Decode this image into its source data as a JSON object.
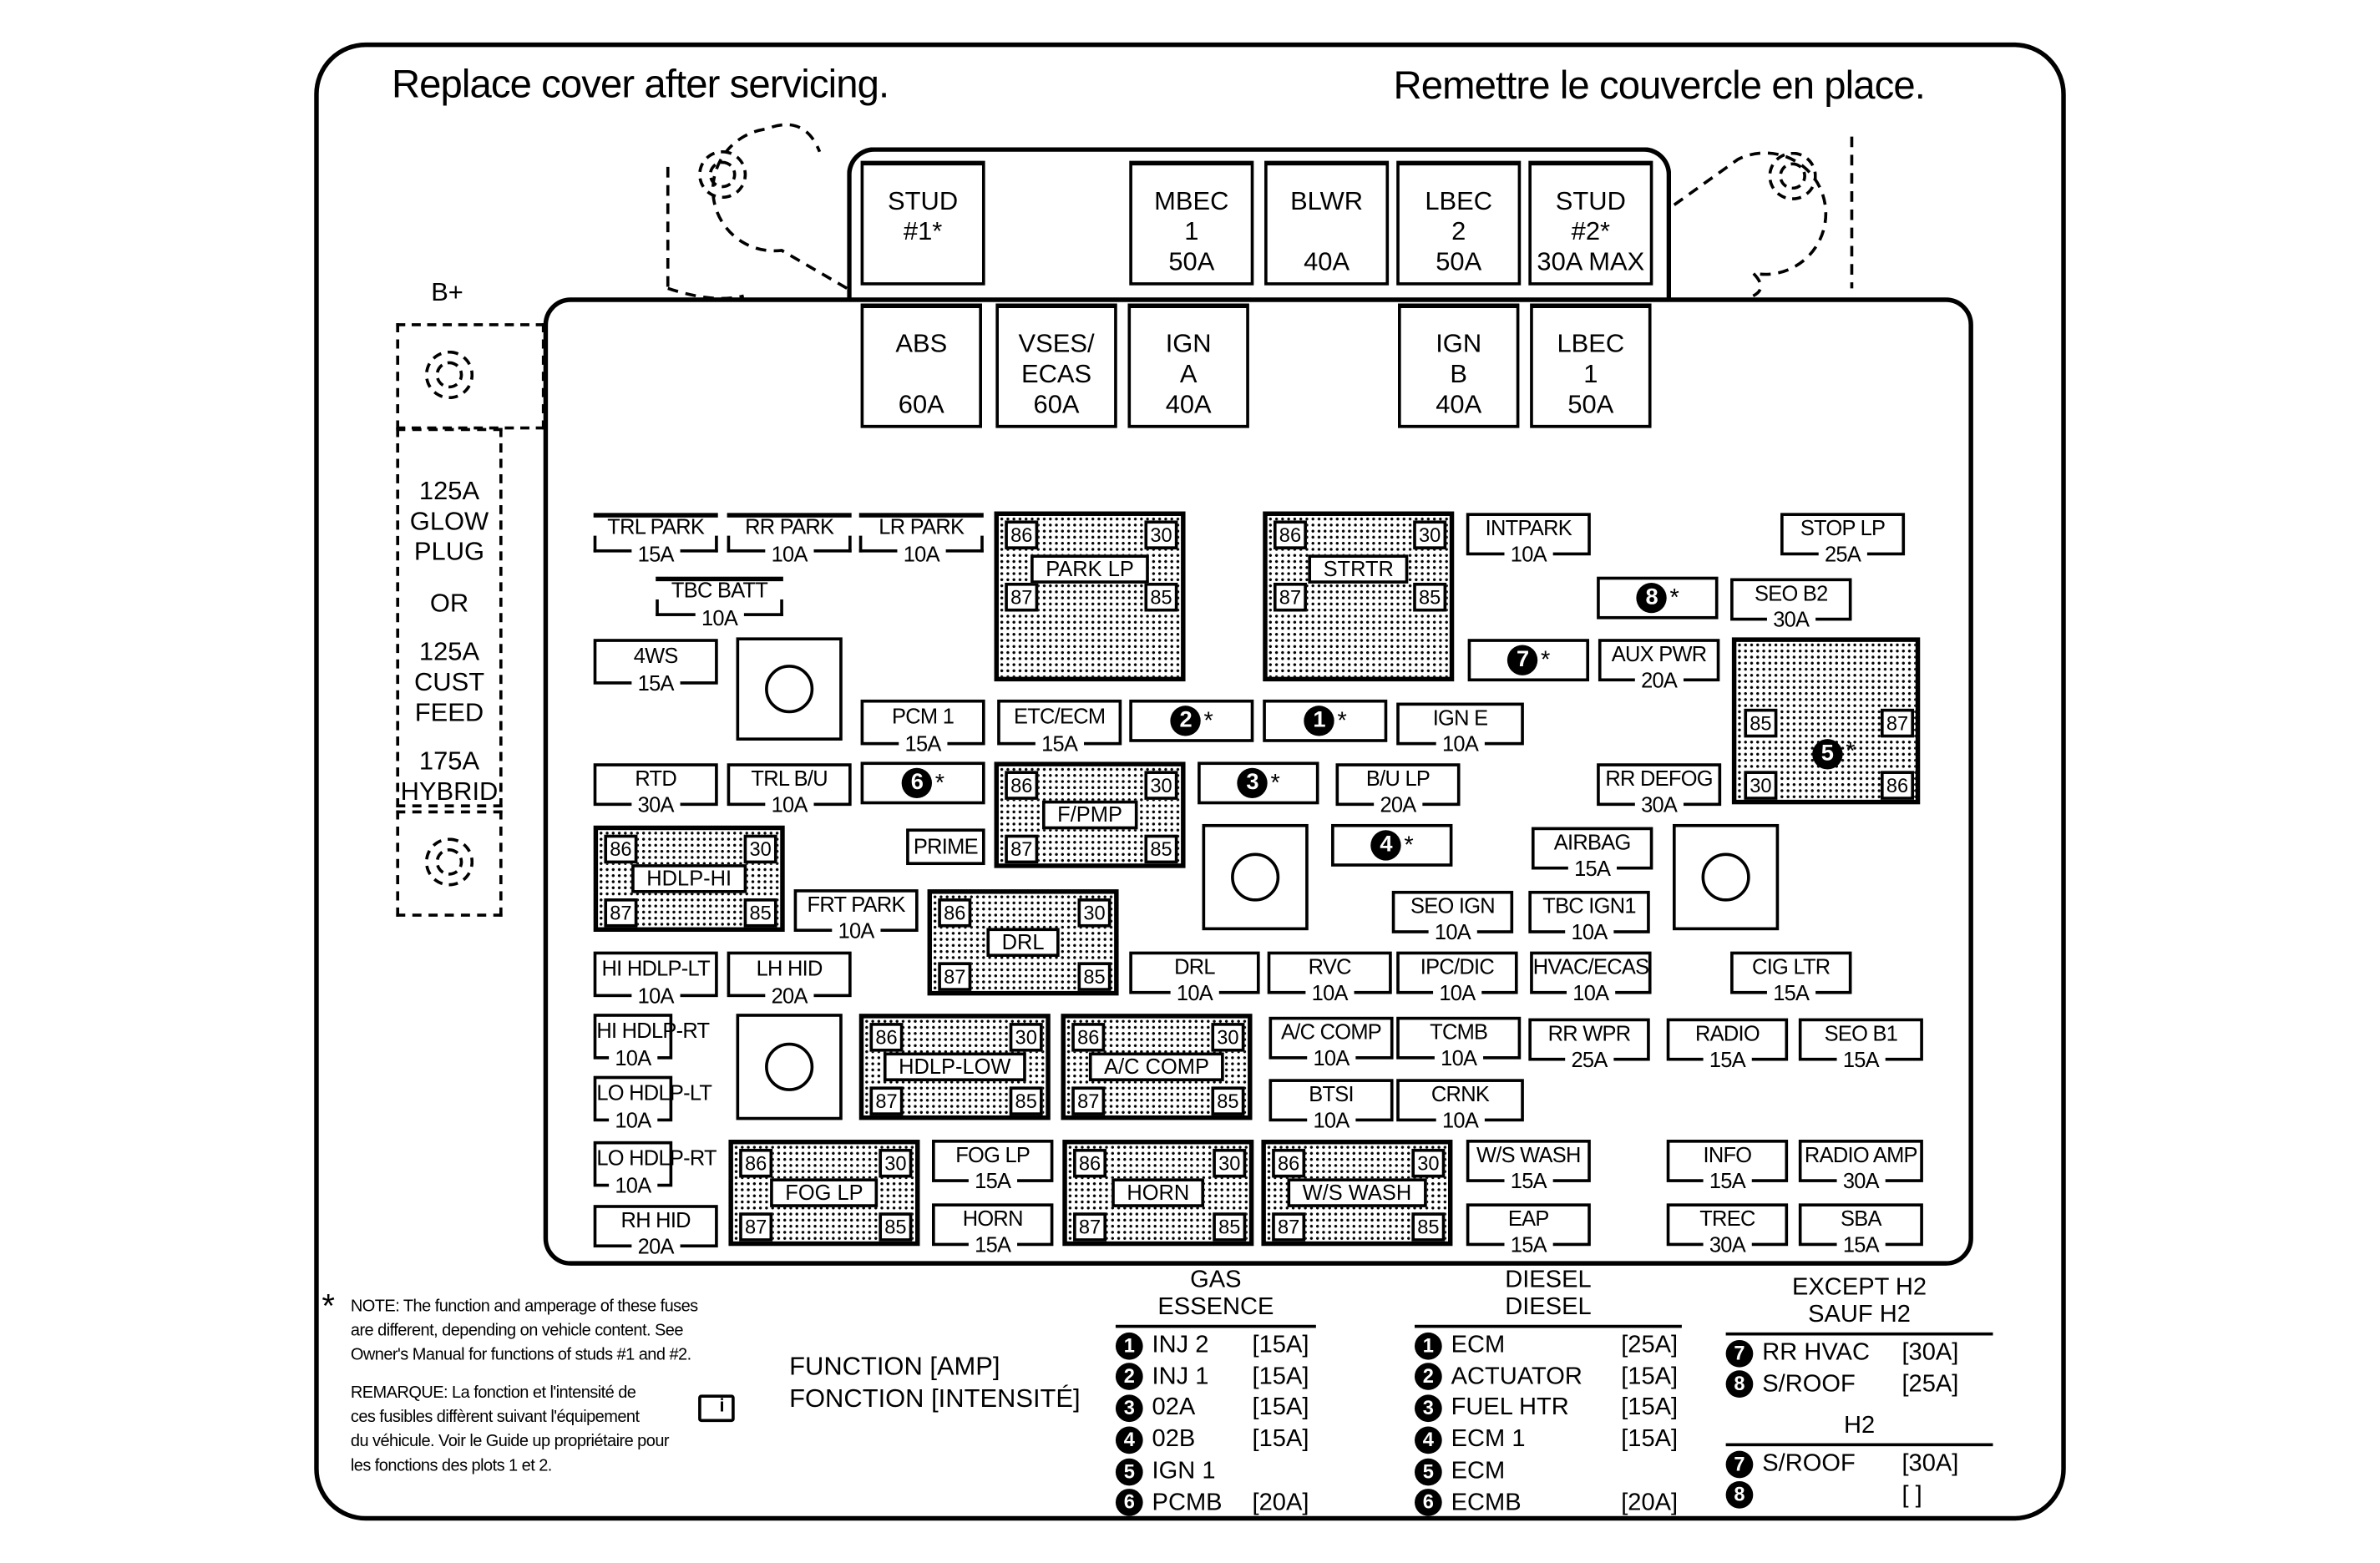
{
  "header": {
    "left_title": "Replace cover after servicing.",
    "right_title": "Remettre le couvercle en place."
  },
  "battery": {
    "label": "B+",
    "options": [
      "125A",
      "GLOW",
      "PLUG",
      "OR",
      "125A",
      "CUST",
      "FEED",
      "175A",
      "HYBRID"
    ]
  },
  "maxi_fuses_top": [
    {
      "lines": [
        "STUD",
        "#1*",
        ""
      ]
    },
    {
      "lines": [
        "MBEC",
        "1",
        "50A"
      ]
    },
    {
      "lines": [
        "BLWR",
        "",
        "40A"
      ]
    },
    {
      "lines": [
        "LBEC",
        "2",
        "50A"
      ]
    },
    {
      "lines": [
        "STUD",
        "#2*",
        "30A MAX"
      ]
    }
  ],
  "maxi_fuses_bottom": [
    {
      "lines": [
        "ABS",
        "",
        "60A"
      ]
    },
    {
      "lines": [
        "VSES/",
        "ECAS",
        "60A"
      ]
    },
    {
      "lines": [
        "IGN",
        "A",
        "40A"
      ]
    },
    {
      "lines": [
        "IGN",
        "B",
        "40A"
      ]
    },
    {
      "lines": [
        "LBEC",
        "1",
        "50A"
      ]
    }
  ],
  "mini_fuses": [
    {
      "name": "TRL PARK",
      "amp": "15A"
    },
    {
      "name": "RR PARK",
      "amp": "10A"
    },
    {
      "name": "LR PARK",
      "amp": "10A"
    },
    {
      "name": "TBC BATT",
      "amp": "10A"
    },
    {
      "name": "4WS",
      "amp": "15A"
    },
    {
      "name": "PCM 1",
      "amp": "15A"
    },
    {
      "name": "ETC/ECM",
      "amp": "15A"
    },
    {
      "name": "RTD",
      "amp": "30A"
    },
    {
      "name": "TRL B/U",
      "amp": "10A"
    },
    {
      "name": "PRIME",
      "amp": ""
    },
    {
      "name": "FRT PARK",
      "amp": "10A"
    },
    {
      "name": "HI HDLP-LT",
      "amp": "10A"
    },
    {
      "name": "LH HID",
      "amp": "20A"
    },
    {
      "name": "HI HDLP-RT",
      "amp": "10A"
    },
    {
      "name": "LO HDLP-LT",
      "amp": "10A"
    },
    {
      "name": "LO HDLP-RT",
      "amp": "10A"
    },
    {
      "name": "RH HID",
      "amp": "20A"
    },
    {
      "name": "FOG LP",
      "amp": "15A"
    },
    {
      "name": "HORN",
      "amp": "15A"
    },
    {
      "name": "INTPARK",
      "amp": "10A"
    },
    {
      "name": "STOP LP",
      "amp": "25A"
    },
    {
      "name": "SEO B2",
      "amp": "30A"
    },
    {
      "name": "AUX PWR",
      "amp": "20A"
    },
    {
      "name": "IGN E",
      "amp": "10A"
    },
    {
      "name": "B/U LP",
      "amp": "20A"
    },
    {
      "name": "RR DEFOG",
      "amp": "30A"
    },
    {
      "name": "AIRBAG",
      "amp": "15A"
    },
    {
      "name": "SEO IGN",
      "amp": "10A"
    },
    {
      "name": "TBC IGN1",
      "amp": "10A"
    },
    {
      "name": "DRL",
      "amp": "10A"
    },
    {
      "name": "RVC",
      "amp": "10A"
    },
    {
      "name": "IPC/DIC",
      "amp": "10A"
    },
    {
      "name": "HVAC/ECAS",
      "amp": "10A"
    },
    {
      "name": "CIG LTR",
      "amp": "15A"
    },
    {
      "name": "A/C COMP",
      "amp": "10A"
    },
    {
      "name": "TCMB",
      "amp": "10A"
    },
    {
      "name": "RR WPR",
      "amp": "25A"
    },
    {
      "name": "RADIO",
      "amp": "15A"
    },
    {
      "name": "SEO B1",
      "amp": "15A"
    },
    {
      "name": "BTSI",
      "amp": "10A"
    },
    {
      "name": "CRNK",
      "amp": "10A"
    },
    {
      "name": "W/S WASH",
      "amp": "15A"
    },
    {
      "name": "EAP",
      "amp": "15A"
    },
    {
      "name": "INFO",
      "amp": "15A"
    },
    {
      "name": "RADIO AMP",
      "amp": "30A"
    },
    {
      "name": "TREC",
      "amp": "30A"
    },
    {
      "name": "SBA",
      "amp": "15A"
    }
  ],
  "numbered_fuses": [
    {
      "num": "2",
      "mark": "*"
    },
    {
      "num": "1",
      "mark": "*"
    },
    {
      "num": "6",
      "mark": "*"
    },
    {
      "num": "3",
      "mark": "*"
    },
    {
      "num": "4",
      "mark": "*"
    },
    {
      "num": "8",
      "mark": "*"
    },
    {
      "num": "7",
      "mark": "*"
    }
  ],
  "relays": [
    {
      "label": "PARK LP",
      "pins": [
        "86",
        "30",
        "87",
        "85"
      ]
    },
    {
      "label": "STRTR",
      "pins": [
        "86",
        "30",
        "87",
        "85"
      ]
    },
    {
      "label": "F/PMP",
      "pins": [
        "86",
        "30",
        "87",
        "85"
      ]
    },
    {
      "label": "HDLP-HI",
      "pins": [
        "86",
        "30",
        "87",
        "85"
      ]
    },
    {
      "label": "DRL",
      "pins": [
        "86",
        "30",
        "87",
        "85"
      ]
    },
    {
      "label": "HDLP-LOW",
      "pins": [
        "86",
        "30",
        "87",
        "85"
      ]
    },
    {
      "label": "A/C COMP",
      "pins": [
        "86",
        "30",
        "87",
        "85"
      ]
    },
    {
      "label": "FOG LP",
      "pins": [
        "86",
        "30",
        "87",
        "85"
      ]
    },
    {
      "label": "HORN",
      "pins": [
        "86",
        "30",
        "87",
        "85"
      ]
    },
    {
      "label": "W/S WASH",
      "pins": [
        "86",
        "30",
        "87",
        "85"
      ]
    }
  ],
  "relay5": {
    "num": "5",
    "mark": "*",
    "pins": [
      "85",
      "87",
      "30",
      "86"
    ]
  },
  "note": {
    "star": "*",
    "english": [
      "NOTE:  The function and amperage of these fuses",
      "are different, depending on vehicle content. See",
      "Owner's Manual for functions of studs #1 and #2."
    ],
    "french": [
      "REMARQUE:  La fonction et l'intensité de",
      "ces fusibles diffèrent suivant l'équipement",
      "du véhicule. Voir le Guide up propriétaire pour",
      "les fonctions des plots 1 et 2."
    ]
  },
  "function_header": [
    "FUNCTION [AMP]",
    "FONCTION [INTENSITÉ]"
  ],
  "legend": {
    "gas": {
      "title": [
        "GAS",
        "ESSENCE"
      ],
      "rows": [
        {
          "num": "1",
          "fn": "INJ 2",
          "amp": "[15A]"
        },
        {
          "num": "2",
          "fn": "INJ 1",
          "amp": "[15A]"
        },
        {
          "num": "3",
          "fn": "02A",
          "amp": "[15A]"
        },
        {
          "num": "4",
          "fn": "02B",
          "amp": "[15A]"
        },
        {
          "num": "5",
          "fn": "IGN 1",
          "amp": ""
        },
        {
          "num": "6",
          "fn": "PCMB",
          "amp": "[20A]"
        }
      ]
    },
    "diesel": {
      "title": [
        "DIESEL",
        "DIESEL"
      ],
      "rows": [
        {
          "num": "1",
          "fn": "ECM",
          "amp": "[25A]"
        },
        {
          "num": "2",
          "fn": "ACTUATOR",
          "amp": "[15A]"
        },
        {
          "num": "3",
          "fn": "FUEL HTR",
          "amp": "[15A]"
        },
        {
          "num": "4",
          "fn": "ECM 1",
          "amp": "[15A]"
        },
        {
          "num": "5",
          "fn": "ECM",
          "amp": ""
        },
        {
          "num": "6",
          "fn": "ECMB",
          "amp": "[20A]"
        }
      ]
    },
    "except_h2": {
      "title": [
        "EXCEPT H2",
        "SAUF H2"
      ],
      "rows": [
        {
          "num": "7",
          "fn": "RR HVAC",
          "amp": "[30A]"
        },
        {
          "num": "8",
          "fn": "S/ROOF",
          "amp": "[25A]"
        }
      ]
    },
    "h2": {
      "title": [
        "H2"
      ],
      "rows": [
        {
          "num": "7",
          "fn": "S/ROOF",
          "amp": "[30A]"
        },
        {
          "num": "8",
          "fn": "",
          "amp": "[    ]"
        }
      ]
    }
  }
}
